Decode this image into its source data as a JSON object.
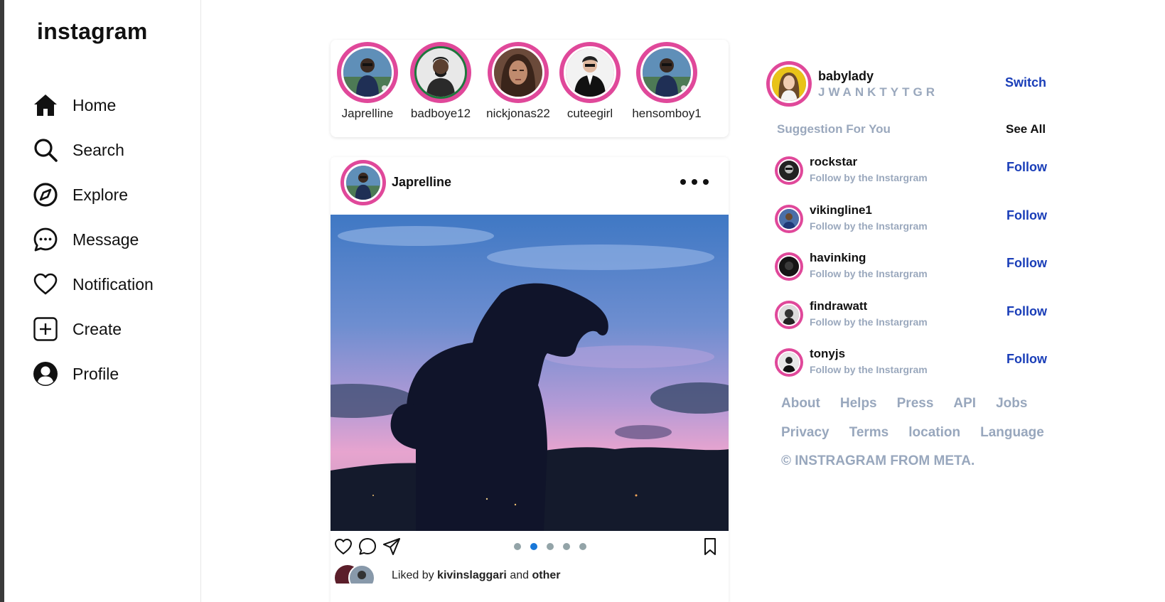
{
  "app": {
    "logo": "instagram"
  },
  "sidebar": {
    "items": [
      {
        "label": "Home",
        "icon": "home-icon"
      },
      {
        "label": "Search",
        "icon": "search-icon"
      },
      {
        "label": "Explore",
        "icon": "compass-icon"
      },
      {
        "label": "Message",
        "icon": "message-icon"
      },
      {
        "label": "Notification",
        "icon": "heart-icon"
      },
      {
        "label": "Create",
        "icon": "plus-square-icon"
      },
      {
        "label": "Profile",
        "icon": "user-icon"
      }
    ]
  },
  "stories": [
    {
      "name": "Japrelline"
    },
    {
      "name": "badboye12"
    },
    {
      "name": "nickjonas22"
    },
    {
      "name": "cuteegirl"
    },
    {
      "name": "hensomboy1"
    }
  ],
  "post": {
    "username": "Japrelline",
    "carousel_count": 5,
    "carousel_active": 2,
    "liked_prefix": "Liked by ",
    "liked_user": "kivinslaggari",
    "liked_middle": " and ",
    "liked_suffix": "other"
  },
  "profile": {
    "username": "babylady",
    "subtitle": "JWANKTYTGR",
    "switch_label": "Switch"
  },
  "suggestions": {
    "title": "Suggestion For You",
    "see_all": "See All",
    "follow_label": "Follow",
    "items": [
      {
        "name": "rockstar",
        "sub": "Follow by the Instargram"
      },
      {
        "name": "vikingline1",
        "sub": "Follow by the Instargram"
      },
      {
        "name": "havinking",
        "sub": "Follow by the Instargram"
      },
      {
        "name": "findrawatt",
        "sub": "Follow by the Instargram"
      },
      {
        "name": "tonyjs",
        "sub": "Follow by the Instargram"
      }
    ]
  },
  "footer": {
    "row1": [
      "About",
      "Helps",
      "Press",
      "API",
      "Jobs"
    ],
    "row2": [
      "Privacy",
      "Terms",
      "location",
      "Language"
    ],
    "copyright": "© INSTRAGRAM FROM META."
  },
  "colors": {
    "accent_pink": "#e0489a",
    "link_blue": "#1a3eb8",
    "muted": "#9aa8bd",
    "dot_active": "#1877d8",
    "dot_inactive": "#93a4a8"
  }
}
